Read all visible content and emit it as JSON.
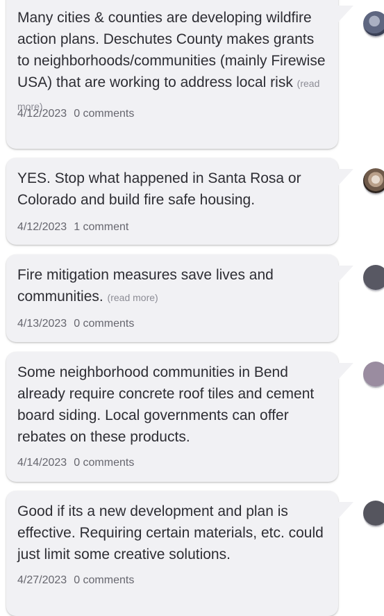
{
  "comments": [
    {
      "text": "Many cities & counties are developing wildfire action plans. Deschutes County makes grants to neighborhoods/communities (mainly Firewise USA) that are working to address local risk",
      "read_more": "(read more)",
      "date": "4/12/2023",
      "comment_count": "0 comments",
      "avatar": "photo-avatar-icon",
      "avatar_color": "#5e6680"
    },
    {
      "text": "YES. Stop what happened in Santa Rosa or Colorado and build fire safe housing.",
      "read_more": "",
      "date": "4/12/2023",
      "comment_count": "1 comment",
      "avatar": "photo-avatar-icon",
      "avatar_color": "#8a7a6c"
    },
    {
      "text": "Fire mitigation measures save lives and communities.",
      "read_more": "(read more)",
      "date": "4/13/2023",
      "comment_count": "0 comments",
      "avatar": "default-avatar-icon",
      "avatar_color": "#585863"
    },
    {
      "text": "Some neighborhood communities in Bend already require concrete roof tiles and cement board siding. Local governments can offer rebates on these products.",
      "read_more": "",
      "date": "4/14/2023",
      "comment_count": "0 comments",
      "avatar": "default-avatar-icon",
      "avatar_color": "#9a8ca0"
    },
    {
      "text": "Good if its a new development and plan is effective. Requiring certain materials, etc. could just limit some creative solutions.",
      "read_more": "",
      "date": "4/27/2023",
      "comment_count": "0 comments",
      "avatar": "default-avatar-icon",
      "avatar_color": "#55555e"
    }
  ]
}
